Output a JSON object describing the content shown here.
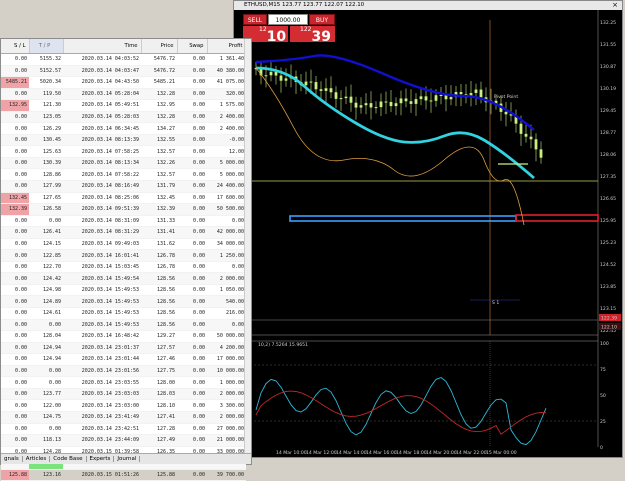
{
  "chart_window": {
    "title": "ETHUSD,M15  123.77 123.77 122.07 122.10",
    "close_glyph": "×",
    "sell_label": "SELL",
    "buy_label": "BUY",
    "lot_value": "1000.00",
    "sell_small": "12",
    "sell_big": "10",
    "buy_small": "122",
    "buy_big": "39",
    "pivot_label": "Pivot Point",
    "s1_label": "S 1",
    "price_scale": [
      "132.25",
      "131.55",
      "130.87",
      "130.19",
      "129.45",
      "128.77",
      "128.06",
      "127.35",
      "126.65",
      "125.95",
      "125.23",
      "124.52",
      "123.85",
      "123.15",
      "122.45"
    ],
    "price_tag_red": "122.39",
    "price_tag_dark": "122.10",
    "indicator_title": "10,2) 7.5264 15.9651",
    "indicator_scale": [
      "100",
      "75",
      "50",
      "25",
      "0"
    ],
    "time_labels": [
      "20",
      "14 Mar 10:00",
      "14 Mar 12:00",
      "14 Mar 14:00",
      "14 Mar 16:00",
      "14 Mar 18:00",
      "14 Mar 20:00",
      "14 Mar 22:00",
      "15 Mar 00:00"
    ],
    "colors": {
      "sell": "#c8262c",
      "ma_slow": "#1010d0",
      "ma_fast": "#32d2e0",
      "candles": "#c8f080",
      "pivot": "#e05030",
      "level_blue": "#3aa0ff"
    }
  },
  "terminal": {
    "columns": [
      "S / L",
      "T / P",
      "Time",
      "Price",
      "Swap",
      "Profit"
    ],
    "rows": [
      [
        "0.00",
        "5155.32",
        "2020.03.14 04:03:52",
        "5476.72",
        "0.00",
        "1 361.40"
      ],
      [
        "0.00",
        "5152.57",
        "2020.03.14 04:03:47",
        "5476.72",
        "0.00",
        "40 380.00"
      ],
      [
        "5485.21",
        "5020.34",
        "2020.03.14 04:43:50",
        "5485.21",
        "0.00",
        "41 075.00"
      ],
      [
        "0.00",
        "119.50",
        "2020.03.14 05:28:04",
        "132.28",
        "0.00",
        "320.00"
      ],
      [
        "132.95",
        "121.30",
        "2020.03.14 05:49:51",
        "132.95",
        "0.00",
        "1 575.00"
      ],
      [
        "0.00",
        "123.05",
        "2020.03.14 05:28:03",
        "132.28",
        "0.00",
        "2 400.00"
      ],
      [
        "0.00",
        "126.29",
        "2020.03.14 06:34:45",
        "134.27",
        "0.00",
        "2 400.00"
      ],
      [
        "0.00",
        "130.45",
        "2020.03.14 08:13:39",
        "132.55",
        "0.00",
        "-0.00"
      ],
      [
        "0.00",
        "125.63",
        "2020.03.14 07:58:25",
        "132.57",
        "0.00",
        "12.00"
      ],
      [
        "0.00",
        "130.39",
        "2020.03.14 08:13:34",
        "132.26",
        "0.00",
        "5 000.00"
      ],
      [
        "0.00",
        "128.86",
        "2020.03.14 07:58:22",
        "132.57",
        "0.00",
        "5 000.00"
      ],
      [
        "0.00",
        "127.99",
        "2020.03.14 08:16:49",
        "131.79",
        "0.00",
        "24 400.00"
      ],
      [
        "132.45",
        "127.65",
        "2020.03.14 08:25:06",
        "132.45",
        "0.00",
        "17 600.00"
      ],
      [
        "132.39",
        "126.58",
        "2020.03.14 09:51:39",
        "132.39",
        "0.00",
        "50 500.00"
      ],
      [
        "0.00",
        "0.00",
        "2020.03.14 08:31:09",
        "131.33",
        "0.00",
        "0.00"
      ],
      [
        "0.00",
        "126.41",
        "2020.03.14 08:31:29",
        "131.41",
        "0.00",
        "42 000.00"
      ],
      [
        "0.00",
        "124.15",
        "2020.03.14 09:49:03",
        "131.62",
        "0.00",
        "34 000.00"
      ],
      [
        "0.00",
        "122.85",
        "2020.03.14 16:01:41",
        "126.78",
        "0.00",
        "1 250.00"
      ],
      [
        "0.00",
        "122.70",
        "2020.03.14 15:03:45",
        "126.78",
        "0.00",
        "0.00"
      ],
      [
        "0.00",
        "124.42",
        "2020.03.14 15:49:54",
        "128.56",
        "0.00",
        "2 000.00"
      ],
      [
        "0.00",
        "124.98",
        "2020.03.14 15:49:53",
        "128.56",
        "0.00",
        "1 050.00"
      ],
      [
        "0.00",
        "124.89",
        "2020.03.14 15:49:53",
        "128.56",
        "0.00",
        "540.00"
      ],
      [
        "0.00",
        "124.61",
        "2020.03.14 15:49:53",
        "128.56",
        "0.00",
        "216.00"
      ],
      [
        "0.00",
        "0.00",
        "2020.03.14 15:49:53",
        "128.56",
        "0.00",
        "0.00"
      ],
      [
        "0.00",
        "128.04",
        "2020.03.14 16:48:42",
        "129.27",
        "0.00",
        "50 000.00"
      ],
      [
        "0.00",
        "124.94",
        "2020.03.14 23:01:37",
        "127.57",
        "0.00",
        "4 200.00"
      ],
      [
        "0.00",
        "124.94",
        "2020.03.14 23:01:44",
        "127.46",
        "0.00",
        "17 000.00"
      ],
      [
        "0.00",
        "0.00",
        "2020.03.14 23:01:56",
        "127.75",
        "0.00",
        "10 000.00"
      ],
      [
        "0.00",
        "0.00",
        "2020.03.14 23:03:55",
        "128.00",
        "0.00",
        "1 000.00"
      ],
      [
        "0.00",
        "123.77",
        "2020.03.14 23:03:03",
        "128.03",
        "0.00",
        "2 000.00"
      ],
      [
        "0.00",
        "122.00",
        "2020.03.14 23:03:00",
        "128.10",
        "0.00",
        "3 300.00"
      ],
      [
        "0.00",
        "124.75",
        "2020.03.14 23:41:49",
        "127.41",
        "0.00",
        "2 000.00"
      ],
      [
        "0.00",
        "0.00",
        "2020.03.14 23:42:51",
        "127.28",
        "0.00",
        "27 000.00"
      ],
      [
        "0.00",
        "118.13",
        "2020.03.14 23:44:09",
        "127.49",
        "0.00",
        "21 000.00"
      ],
      [
        "0.00",
        "124.28",
        "2020.03.15 01:39:58",
        "126.35",
        "0.00",
        "33 000.00"
      ],
      [
        "0.00",
        "124.75",
        "2020.03.15 01:24:03",
        "125.88",
        "0.00",
        "170 000.00"
      ],
      [
        "125.88",
        "123.16",
        "2020.03.15 01:51:26",
        "125.88",
        "0.00",
        "39 700.00"
      ]
    ],
    "tabs": [
      "gnals",
      "Articles",
      "Code Base",
      "Experts",
      "Journal"
    ]
  }
}
